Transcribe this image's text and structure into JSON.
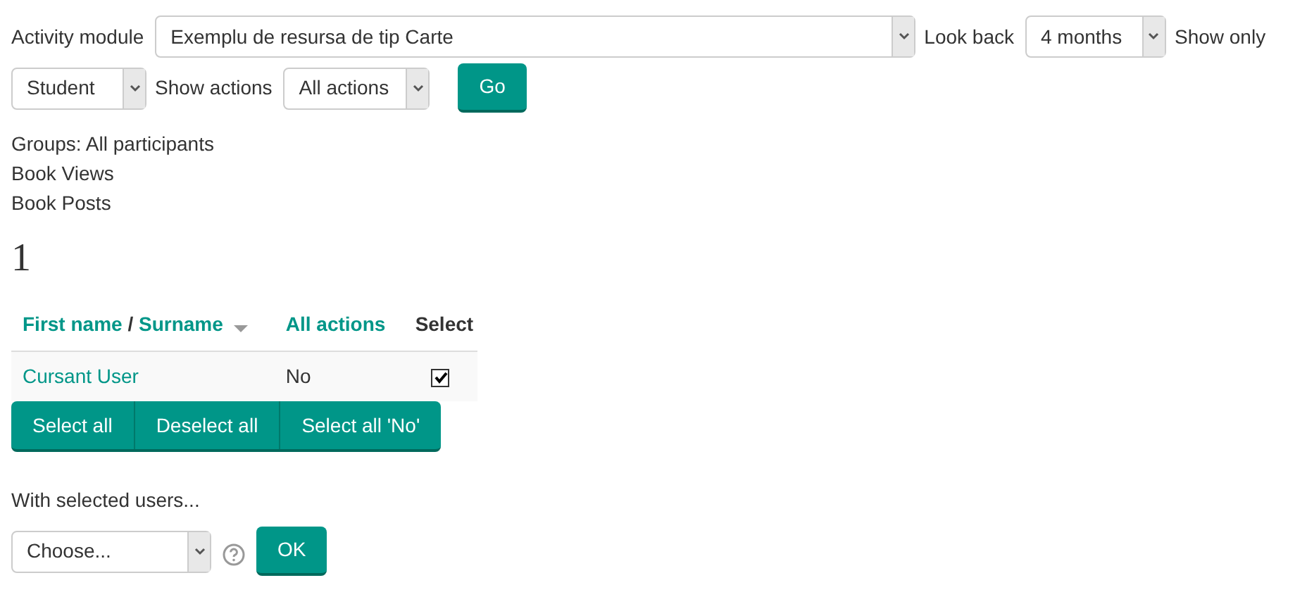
{
  "filter_rows": [
    [
      {
        "kind": "label",
        "text": "Activity module"
      },
      {
        "kind": "select",
        "text": "Exemplu de resursa de tip Carte"
      },
      {
        "kind": "label",
        "text": "Look back"
      },
      {
        "kind": "select",
        "text": "4 months"
      },
      {
        "kind": "label",
        "text": "Show only"
      }
    ],
    [
      {
        "kind": "select",
        "text": "Student"
      },
      {
        "kind": "label",
        "text": "Show actions"
      },
      {
        "kind": "select",
        "text": "All actions"
      },
      {
        "kind": "button",
        "text": "Go"
      }
    ]
  ],
  "info_lines": [
    "Groups: All participants",
    "Book Views",
    "Book Posts"
  ],
  "count": "1",
  "table": {
    "columns": [
      {
        "kind": "sort",
        "parts": [
          "First name",
          " / ",
          "Surname"
        ]
      },
      {
        "kind": "link",
        "parts": [
          "All actions"
        ]
      },
      {
        "kind": "plain",
        "parts": [
          "Select"
        ]
      }
    ],
    "rows": [
      {
        "name": "Cursant User",
        "actions": "No",
        "checked": true
      }
    ]
  },
  "select_buttons": [
    "Select all",
    "Deselect all",
    "Select all 'No'"
  ],
  "with_selected": {
    "label": "With selected users...",
    "value": "Choose...",
    "button": "OK"
  }
}
